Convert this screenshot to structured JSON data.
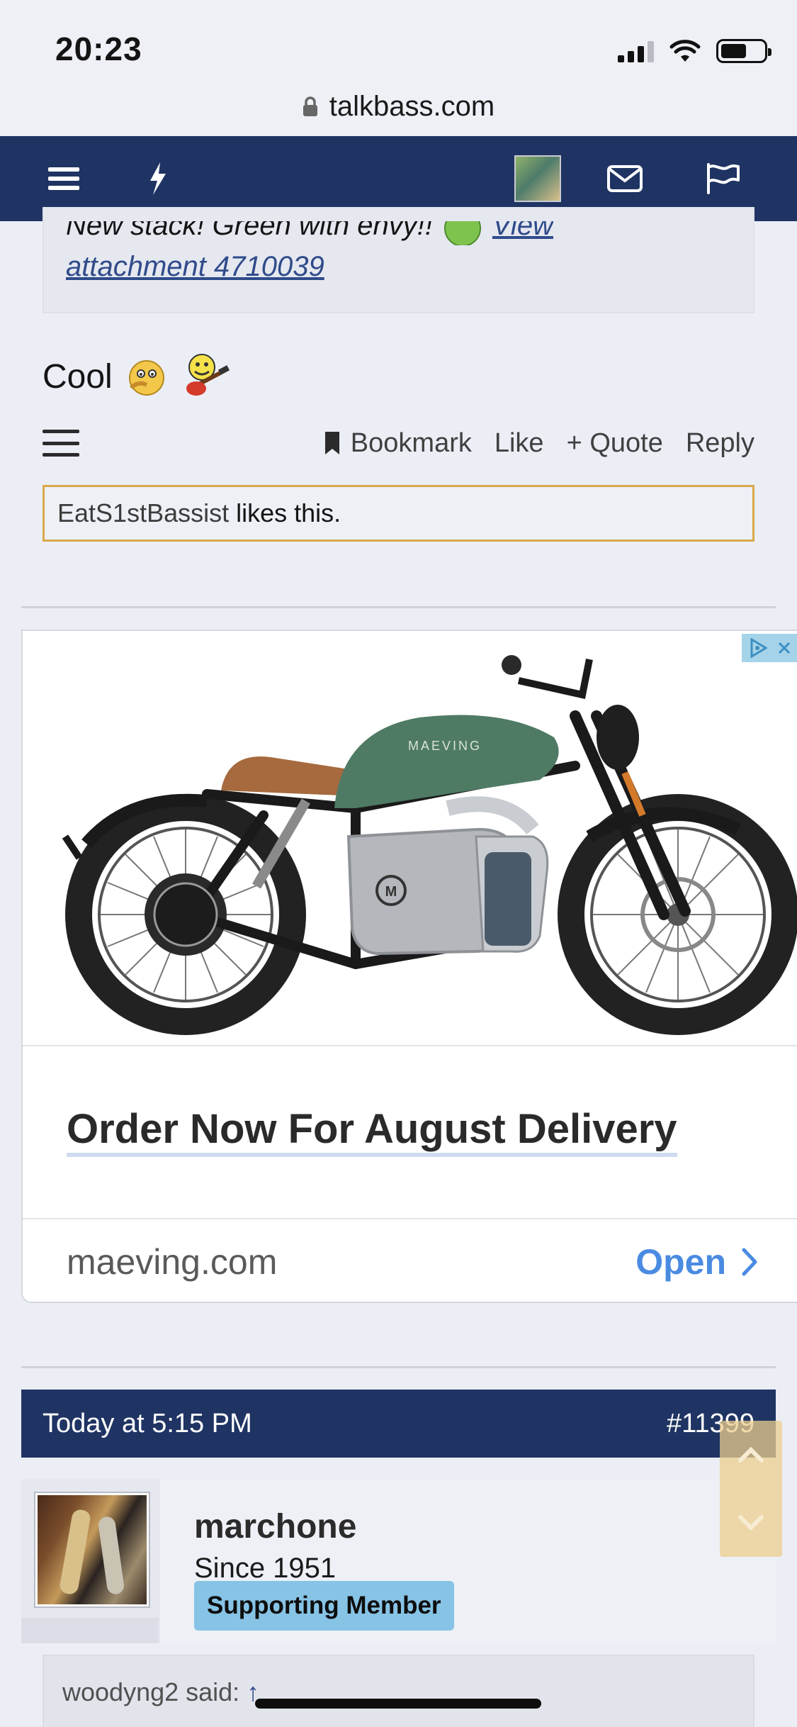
{
  "status_bar": {
    "time": "20:23"
  },
  "browser": {
    "url": "talkbass.com"
  },
  "quoted_post": {
    "text": "New stack! Green with envy!!",
    "link_1": "View",
    "link_2": "attachment 4710039"
  },
  "post": {
    "text": "Cool",
    "actions": {
      "bookmark": "Bookmark",
      "like": "Like",
      "quote": "+ Quote",
      "reply": "Reply"
    },
    "likes": {
      "user": "EatS1stBassist",
      "suffix": " likes this."
    }
  },
  "ad": {
    "brand_on_tank": "MAEVING",
    "headline": "Order Now For August Delivery",
    "domain": "maeving.com",
    "cta": "Open"
  },
  "next_post": {
    "timestamp": "Today at 5:15 PM",
    "number": "#11399",
    "username": "marchone",
    "since": "Since 1951",
    "badge": "Supporting Member",
    "quote_attribution": "woodyng2 said:",
    "quote_arrow": "↑"
  },
  "colors": {
    "nav_blue": "#1f3463",
    "likes_border": "#d9a94a",
    "badge_blue": "#86c3e5",
    "cta_blue": "#4a8be2",
    "link_blue": "#2f4b8a"
  }
}
